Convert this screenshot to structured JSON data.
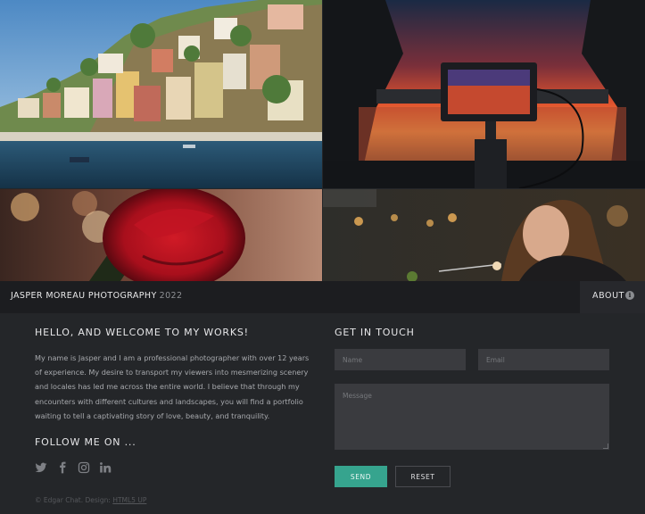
{
  "gallery": {
    "images": [
      {
        "subject": "coastal village with colorful houses by the sea"
      },
      {
        "subject": "camera monitor capturing a sunset over a lake"
      },
      {
        "subject": "red rose with bokeh lights"
      },
      {
        "subject": "woman smiling while eating at a restaurant"
      }
    ]
  },
  "header": {
    "brand": "JASPER MOREAU PHOTOGRAPHY",
    "year": "2022",
    "about_label": "ABOUT",
    "info_icon": "i"
  },
  "welcome": {
    "title": "HELLO, AND WELCOME TO MY WORKS!",
    "text": "My name is Jasper and I am a professional photographer with over 12 years of experience. My desire to transport my viewers into mesmerizing scenery and locales has led me across the entire world. I believe that through my encounters with different cultures and landscapes, you will find a portfolio waiting to tell a captivating story of love, beauty, and tranquility."
  },
  "follow": {
    "title": "FOLLOW ME ON ...",
    "icons": [
      "twitter-icon",
      "facebook-icon",
      "instagram-icon",
      "linkedin-icon"
    ]
  },
  "footer": {
    "credit_prefix": "© Edgar Chat. Design: ",
    "credit_link": "HTML5 UP"
  },
  "contact": {
    "title": "GET IN TOUCH",
    "name_placeholder": "Name",
    "email_placeholder": "Email",
    "message_placeholder": "Message",
    "send_label": "SEND",
    "reset_label": "RESET"
  },
  "colors": {
    "background": "#242629",
    "bar": "#1c1d20",
    "field": "#3a3b3f",
    "accent": "#36a48e"
  }
}
